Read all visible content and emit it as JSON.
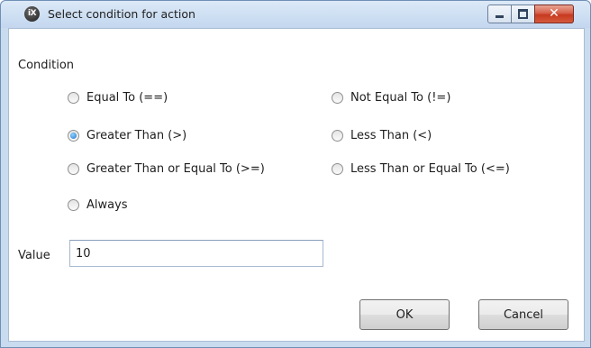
{
  "window": {
    "title": "Select condition for action",
    "app_icon_text": "iX",
    "controls": {
      "minimize": "minimize-icon",
      "maximize": "maximize-icon",
      "close": "close-icon",
      "close_glyph": "✕"
    },
    "colors": {
      "frame": "#c9dbef",
      "close_button": "#c7391f"
    }
  },
  "condition": {
    "label": "Condition",
    "selected": "greater_than",
    "options": [
      {
        "id": "equal_to",
        "label": "Equal To (==)",
        "checked": false
      },
      {
        "id": "not_equal_to",
        "label": "Not Equal To (!=)",
        "checked": false
      },
      {
        "id": "greater_than",
        "label": "Greater Than (>)",
        "checked": true
      },
      {
        "id": "less_than",
        "label": "Less Than (<)",
        "checked": false
      },
      {
        "id": "greater_than_or_equal",
        "label": "Greater Than or Equal To (>=)",
        "checked": false
      },
      {
        "id": "less_than_or_equal",
        "label": "Less Than or Equal To (<=)",
        "checked": false
      },
      {
        "id": "always",
        "label": "Always",
        "checked": false
      }
    ]
  },
  "value": {
    "label": "Value",
    "current": "10"
  },
  "buttons": {
    "ok": "OK",
    "cancel": "Cancel"
  }
}
